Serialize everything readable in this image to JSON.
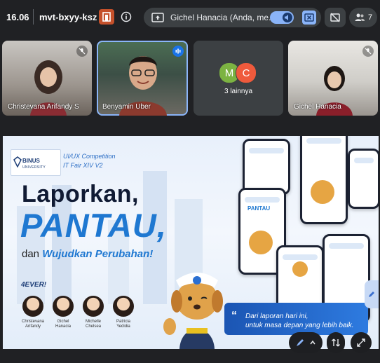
{
  "topbar": {
    "time": "16.06",
    "meeting_code": "mvt-bxyy-ksz",
    "presenting_text": "Gichel Hanacia (Anda, me...",
    "participants_count": "7"
  },
  "participants": [
    {
      "name": "Christevana Arifandy S",
      "muted": true
    },
    {
      "name": "Benyamin Uber",
      "speaking": true
    },
    {
      "others_label": "3 lainnya",
      "initials": [
        "M",
        "C"
      ]
    },
    {
      "name": "Gichel Hanacia",
      "muted": true
    }
  ],
  "slide": {
    "logo_text": "BINUS",
    "logo_sub": "UNIVERSITY",
    "competition_line1": "UI/UX Competition",
    "competition_line2": "IT Fair XIV V2",
    "headline1": "Laporkan,",
    "headline2": "PANTAU,",
    "headline3_prefix": "dan",
    "headline3_emph": "Wujudkan Perubahan!",
    "team": "4EVER!",
    "members": [
      {
        "line1": "Christevana",
        "line2": "Arifandy"
      },
      {
        "line1": "Gichel",
        "line2": "Hanacia"
      },
      {
        "line1": "Michelle",
        "line2": "Chelsea"
      },
      {
        "line1": "Patricia",
        "line2": "Yedidia"
      }
    ],
    "app_name": "PANTAU",
    "quote_line1": "Dari laporan hari ini,",
    "quote_line2": "untuk masa depan yang lebih baik."
  },
  "colors": {
    "background": "#202124",
    "accent": "#8ab4f8",
    "brand_blue": "#1f78d1"
  }
}
